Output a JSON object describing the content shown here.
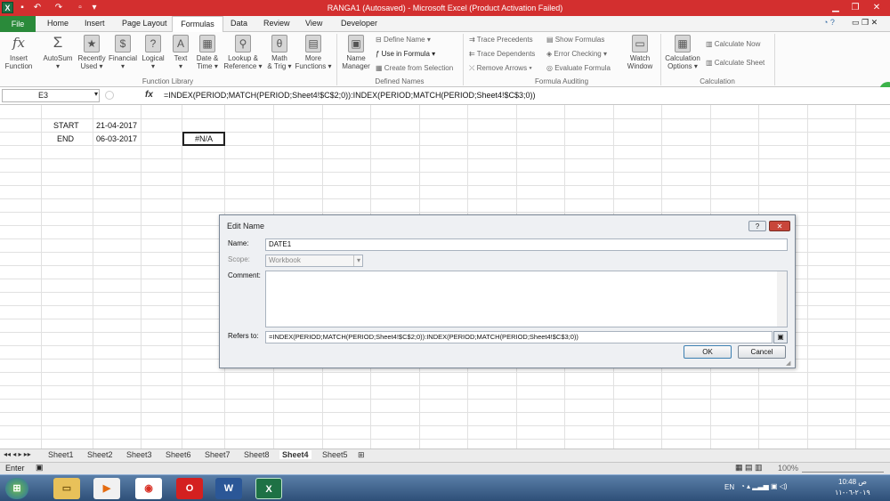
{
  "window": {
    "title": "RANGA1 (Autosaved)  -  Microsoft Excel (Product Activation Failed)"
  },
  "colors": {
    "titlebar": "#d32f2f",
    "file_tab": "#2a8a3a",
    "accent": "#1e7145"
  },
  "menu_tabs": [
    "File",
    "Home",
    "Insert",
    "Page Layout",
    "Formulas",
    "Data",
    "Review",
    "View",
    "Developer"
  ],
  "ribbon": {
    "insert_function": [
      "Insert",
      "Function"
    ],
    "autosum": "AutoSum",
    "recently_used": [
      "Recently",
      "Used"
    ],
    "financial": "Financial",
    "logical": "Logical",
    "text": "Text",
    "date_time": [
      "Date &",
      "Time"
    ],
    "lookup_reference": [
      "Lookup &",
      "Reference"
    ],
    "math_trig": [
      "Math",
      "& Trig"
    ],
    "more_functions": [
      "More",
      "Functions"
    ],
    "function_library": "Function Library",
    "name_manager": [
      "Name",
      "Manager"
    ],
    "define_name": "Define Name",
    "use_in_formula": "Use in Formula",
    "create_from_selection": "Create from Selection",
    "defined_names": "Defined Names",
    "trace_precedents": "Trace Precedents",
    "trace_dependents": "Trace Dependents",
    "remove_arrows": "Remove Arrows",
    "show_formulas": "Show Formulas",
    "error_checking": "Error Checking",
    "evaluate_formula": "Evaluate Formula",
    "watch_window": [
      "Watch",
      "Window"
    ],
    "formula_auditing": "Formula Auditing",
    "calculation_options": [
      "Calculation",
      "Options"
    ],
    "calculate_now": "Calculate Now",
    "calculate_sheet": "Calculate Sheet",
    "calculation": "Calculation"
  },
  "formula_bar": {
    "name_box": "E3",
    "fx": "fx",
    "formula": "=INDEX(PERIOD;MATCH(PERIOD;Sheet4!$C$2;0)):INDEX(PERIOD;MATCH(PERIOD;Sheet4!$C$3;0))"
  },
  "cells": {
    "start_label": "START",
    "start_value": "21-04-2017",
    "end_label": "END",
    "end_value": "06-03-2017",
    "error_value": "#N/A"
  },
  "dialog": {
    "title": "Edit Name",
    "name_label": "Name:",
    "name_value": "DATE1",
    "scope_label": "Scope:",
    "scope_value": "Workbook",
    "comment_label": "Comment:",
    "comment_value": "",
    "refers_to_label": "Refers to:",
    "refers_to_value": "=INDEX(PERIOD;MATCH(PERIOD;Sheet4!$C$2;0)):INDEX(PERIOD;MATCH(PERIOD;Sheet4!$C$3;0))",
    "ok": "OK",
    "cancel": "Cancel",
    "help": "?",
    "close": "✕"
  },
  "sheets": [
    "Sheet1",
    "Sheet2",
    "Sheet3",
    "Sheet6",
    "Sheet7",
    "Sheet8",
    "Sheet4",
    "Sheet5"
  ],
  "active_sheet": "Sheet4",
  "status": {
    "mode": "Enter",
    "zoom": "100%"
  },
  "taskbar": {
    "lang": "EN",
    "time": "10:48 ص",
    "date": "٢٠١٩-٠٦-١١"
  }
}
